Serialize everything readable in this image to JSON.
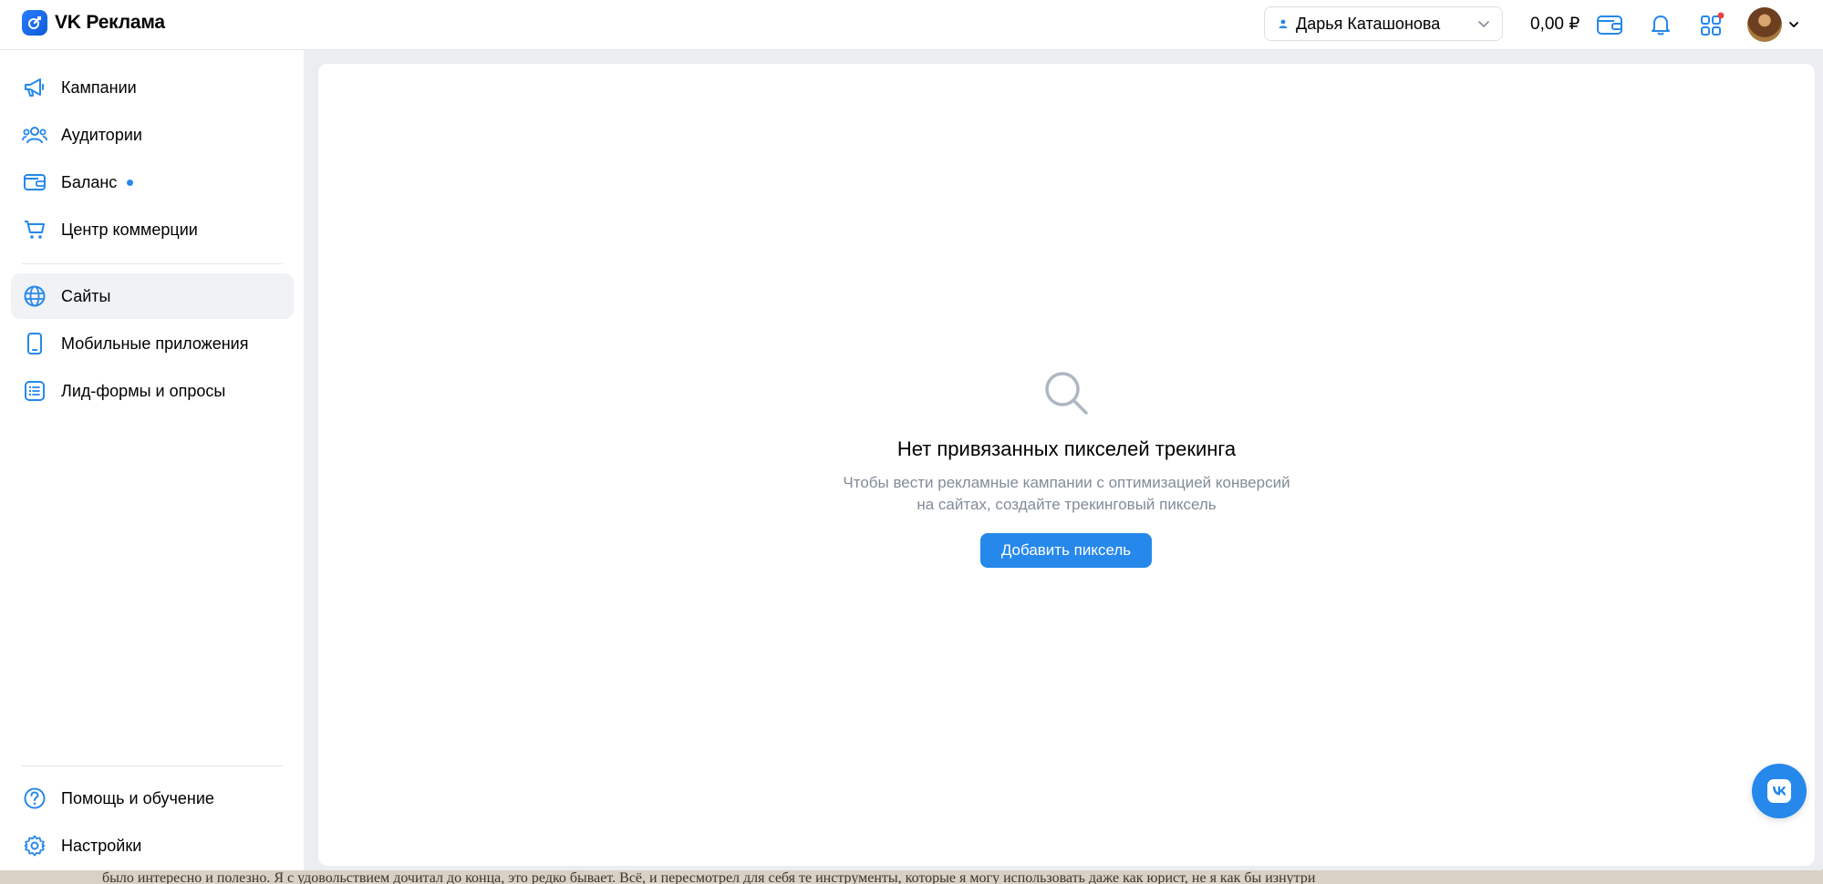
{
  "header": {
    "logo_text": "VK Реклама",
    "account_name": "Дарья Каташонова",
    "balance": "0,00 ₽"
  },
  "sidebar": {
    "items": [
      {
        "label": "Кампании",
        "icon": "megaphone-icon"
      },
      {
        "label": "Аудитории",
        "icon": "users-icon"
      },
      {
        "label": "Баланс",
        "icon": "wallet-icon"
      },
      {
        "label": "Центр коммерции",
        "icon": "cart-icon"
      },
      {
        "label": "Сайты",
        "icon": "globe-icon",
        "active": true
      },
      {
        "label": "Мобильные приложения",
        "icon": "smartphone-icon"
      },
      {
        "label": "Лид-формы и опросы",
        "icon": "list-form-icon"
      }
    ],
    "bottom": [
      {
        "label": "Помощь и обучение",
        "icon": "help-icon"
      },
      {
        "label": "Настройки",
        "icon": "gear-icon"
      }
    ]
  },
  "main": {
    "empty_title": "Нет привязанных пикселей трекинга",
    "empty_desc_line1": "Чтобы вести рекламные кампании с оптимизацией конверсий",
    "empty_desc_line2": "на сайтах, создайте трекинговый пиксель",
    "add_button": "Добавить пиксель"
  },
  "background": {
    "partial_text": "было интересно и полезно. Я с удовольствием дочитал до конца, это редко бывает. Всё, и пересмотрел для себя те инструменты, которые я могу использовать даже как юрист, не я как бы изнутри"
  },
  "colors": {
    "accent": "#2688eb",
    "icon_blue": "#2688eb",
    "text_secondary": "#818c99",
    "notification": "#e64646"
  }
}
